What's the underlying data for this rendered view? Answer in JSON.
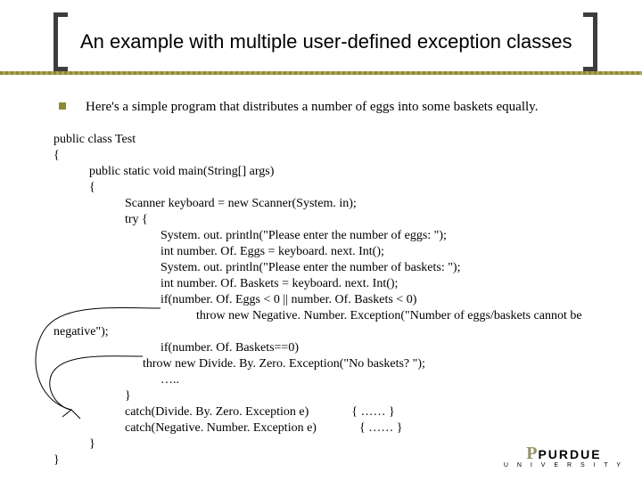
{
  "title": "An example with multiple user-defined exception classes",
  "intro": "Here's a simple program that distributes a number of eggs into some baskets equally.",
  "code": {
    "l0": "public class Test",
    "l1": "{",
    "l2": "public static void main(String[] args)",
    "l3": "{",
    "l4": "Scanner keyboard = new Scanner(System. in);",
    "l5": "try {",
    "l6": "System. out. println(\"Please enter the number of eggs: \");",
    "l7": "int number. Of. Eggs = keyboard. next. Int();",
    "l8": "System. out. println(\"Please enter the number of baskets: \");",
    "l9": "int number. Of. Baskets = keyboard. next. Int();",
    "l10": "if(number. Of. Eggs < 0 || number. Of. Baskets < 0)",
    "l11a": "throw new Negative. Number. Exception(\"Number of eggs/baskets cannot be",
    "l11b": "negative\");",
    "l12": "if(number. Of. Baskets==0)",
    "l13": "throw new Divide. By. Zero. Exception(\"No baskets? \");",
    "l14": "…..",
    "l15": "}",
    "l16a": "catch(Divide. By. Zero. Exception e)",
    "l16b": "{        …… }",
    "l17a": "catch(Negative. Number. Exception e)",
    "l17b": "{        …… }",
    "l18": "}",
    "l19": "}"
  },
  "logo": {
    "brand": "PURDUE",
    "sub": "U N I V E R S I T Y"
  }
}
